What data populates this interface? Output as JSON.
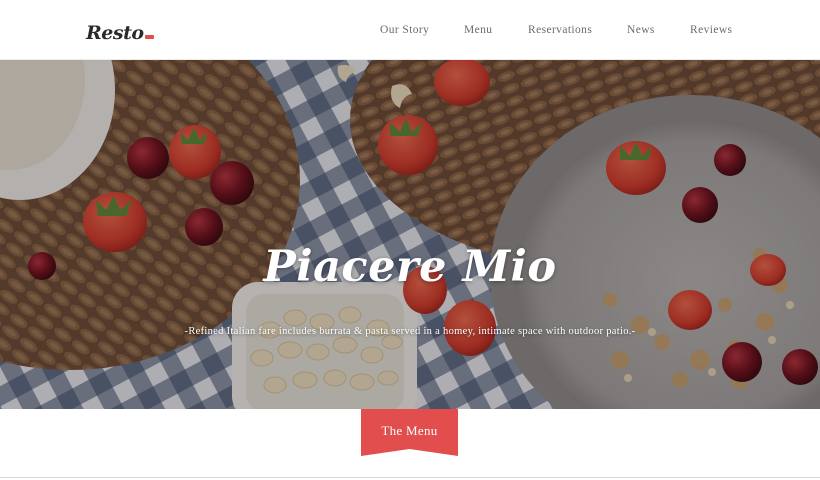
{
  "header": {
    "logo": "Resto",
    "nav": [
      {
        "label": "Our Story"
      },
      {
        "label": "Menu"
      },
      {
        "label": "Reservations"
      },
      {
        "label": "News"
      },
      {
        "label": "Reviews"
      }
    ]
  },
  "hero": {
    "title": "Piacere Mio",
    "subtitle": "-Refined Italian fare includes burrata & pasta served in a homey, intimate space with outdoor patio.-"
  },
  "menu_tab": {
    "label": "The Menu"
  },
  "colors": {
    "accent": "#e24d4d",
    "nav_text": "#6b6b6b",
    "header_bg": "#ffffff"
  }
}
